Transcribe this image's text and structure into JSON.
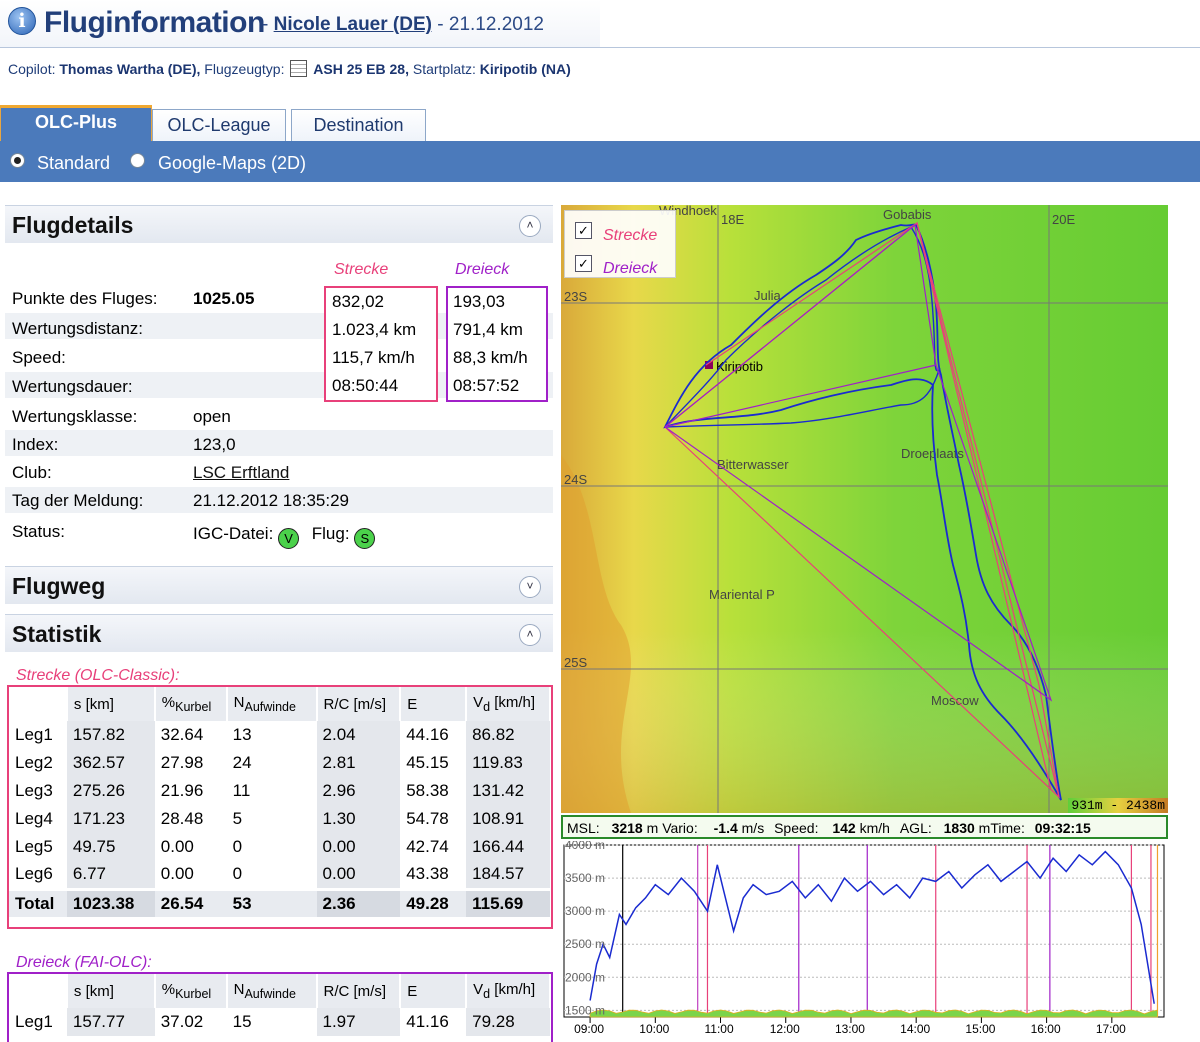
{
  "header": {
    "title": "Fluginformation",
    "separator": " - ",
    "pilot": "Nicole Lauer (DE)",
    "date_prefix": " - ",
    "date": "21.12.2012"
  },
  "subheader": {
    "copilot_label": "Copilot:",
    "copilot": "Thomas Wartha (DE),",
    "type_label": "Flugzeugtyp:",
    "type": "ASH 25 EB 28,",
    "start_label": "Startplatz:",
    "start": "Kiripotib (NA)"
  },
  "tabs": [
    "OLC-Plus",
    "OLC-League",
    "Destination"
  ],
  "view_options": {
    "standard": "Standard",
    "google": "Google-Maps (2D)",
    "selected": "Standard"
  },
  "flugdetails": {
    "title": "Flugdetails",
    "col_strecke": "Strecke",
    "col_dreieck": "Dreieck",
    "rows": [
      {
        "label": "Punkte des Fluges:",
        "value": "1025.05",
        "strecke": "832,02",
        "dreieck": "193,03"
      },
      {
        "label": "Wertungsdistanz:",
        "value": "",
        "strecke": "1.023,4 km",
        "dreieck": "791,4 km"
      },
      {
        "label": "Speed:",
        "value": "",
        "strecke": "115,7 km/h",
        "dreieck": "88,3 km/h"
      },
      {
        "label": "Wertungsdauer:",
        "value": "",
        "strecke": "08:50:44",
        "dreieck": "08:57:52"
      }
    ],
    "wertungsklasse_label": "Wertungsklasse:",
    "wertungsklasse": "open",
    "index_label": "Index:",
    "index": "123,0",
    "club_label": "Club:",
    "club": "LSC Erftland",
    "meldung_label": "Tag der Meldung:",
    "meldung": "21.12.2012 18:35:29",
    "status_label": "Status:",
    "igc_label": "IGC-Datei:",
    "igc_badge": "V",
    "flug_label": "Flug:",
    "flug_badge": "S"
  },
  "flugweg": {
    "title": "Flugweg"
  },
  "statistik": {
    "title": "Statistik",
    "strecke_caption": "Strecke (OLC-Classic):",
    "dreieck_caption": "Dreieck (FAI-OLC):",
    "headers": {
      "s": "s [km]",
      "kurbel_pct": "%",
      "kurbel_sub": "Kurbel",
      "n": "N",
      "n_sub": "Aufwinde",
      "rc": "R/C [m/s]",
      "e": "E",
      "vd": "V",
      "vd_sub": "d",
      "vd_unit": " [km/h]"
    },
    "strecke_rows": [
      [
        "Leg1",
        "157.82",
        "32.64",
        "13",
        "2.04",
        "44.16",
        "86.82"
      ],
      [
        "Leg2",
        "362.57",
        "27.98",
        "24",
        "2.81",
        "45.15",
        "119.83"
      ],
      [
        "Leg3",
        "275.26",
        "21.96",
        "11",
        "2.96",
        "58.38",
        "131.42"
      ],
      [
        "Leg4",
        "171.23",
        "28.48",
        "5",
        "1.30",
        "54.78",
        "108.91"
      ],
      [
        "Leg5",
        "49.75",
        "0.00",
        "0",
        "0.00",
        "42.74",
        "166.44"
      ],
      [
        "Leg6",
        "6.77",
        "0.00",
        "0",
        "0.00",
        "43.38",
        "184.57"
      ]
    ],
    "strecke_total": [
      "Total",
      "1023.38",
      "26.54",
      "53",
      "2.36",
      "49.28",
      "115.69"
    ],
    "dreieck_rows": [
      [
        "Leg1",
        "157.77",
        "37.02",
        "15",
        "1.97",
        "41.16",
        "79.28"
      ]
    ]
  },
  "map": {
    "legend": [
      {
        "label": "Strecke",
        "checked": true,
        "color": "#e8407a"
      },
      {
        "label": "Dreieck",
        "checked": true,
        "color": "#a020c8"
      }
    ],
    "places": [
      "Windhoek",
      "Gobabis",
      "Julia",
      "Kiripotib",
      "Bitterwasser",
      "Droeplaats",
      "Mariental P",
      "Moscow"
    ],
    "lon_labels": [
      "18E",
      "20E"
    ],
    "lat_labels": [
      "23S",
      "24S",
      "25S"
    ],
    "scale": "931m - 2438m"
  },
  "barogram": {
    "msl_label": "MSL:",
    "msl": "3218",
    "msl_unit": " m",
    "vario_label": "Vario:",
    "vario": "-1.4",
    "vario_unit": " m/s",
    "speed_label": "Speed:",
    "speed": "142",
    "speed_unit": " km/h",
    "agl_label": "AGL:",
    "agl": "1830",
    "agl_unit": " m",
    "time_label": "Time:",
    "time": "09:32:15",
    "y_ticks": [
      "4000 m",
      "3500 m",
      "3000 m",
      "2500 m",
      "2000 m",
      "1500 m"
    ],
    "x_ticks": [
      "09:00",
      "10:00",
      "11:00",
      "12:00",
      "13:00",
      "14:00",
      "15:00",
      "16:00",
      "17:00"
    ]
  }
}
